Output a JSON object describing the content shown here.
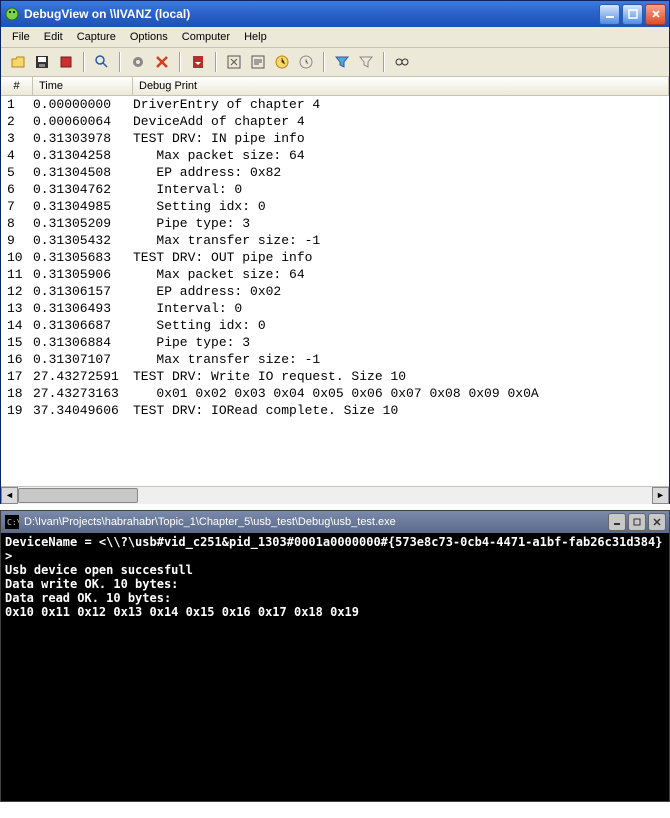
{
  "debugview": {
    "title": "DebugView on \\\\IVANZ (local)",
    "menu": [
      "File",
      "Edit",
      "Capture",
      "Options",
      "Computer",
      "Help"
    ],
    "columns": {
      "num": "#",
      "time": "Time",
      "msg": "Debug Print"
    },
    "rows": [
      {
        "n": "1",
        "t": "0.00000000",
        "m": "DriverEntry of chapter 4"
      },
      {
        "n": "2",
        "t": "0.00060064",
        "m": "DeviceAdd of chapter 4"
      },
      {
        "n": "3",
        "t": "0.31303978",
        "m": "TEST DRV: IN pipe info"
      },
      {
        "n": "4",
        "t": "0.31304258",
        "m": "   Max packet size: 64"
      },
      {
        "n": "5",
        "t": "0.31304508",
        "m": "   EP address: 0x82"
      },
      {
        "n": "6",
        "t": "0.31304762",
        "m": "   Interval: 0"
      },
      {
        "n": "7",
        "t": "0.31304985",
        "m": "   Setting idx: 0"
      },
      {
        "n": "8",
        "t": "0.31305209",
        "m": "   Pipe type: 3"
      },
      {
        "n": "9",
        "t": "0.31305432",
        "m": "   Max transfer size: -1"
      },
      {
        "n": "10",
        "t": "0.31305683",
        "m": "TEST DRV: OUT pipe info"
      },
      {
        "n": "11",
        "t": "0.31305906",
        "m": "   Max packet size: 64"
      },
      {
        "n": "12",
        "t": "0.31306157",
        "m": "   EP address: 0x02"
      },
      {
        "n": "13",
        "t": "0.31306493",
        "m": "   Interval: 0"
      },
      {
        "n": "14",
        "t": "0.31306687",
        "m": "   Setting idx: 0"
      },
      {
        "n": "15",
        "t": "0.31306884",
        "m": "   Pipe type: 3"
      },
      {
        "n": "16",
        "t": "0.31307107",
        "m": "   Max transfer size: -1"
      },
      {
        "n": "17",
        "t": "27.43272591",
        "m": "TEST DRV: Write IO request. Size 10"
      },
      {
        "n": "18",
        "t": "27.43273163",
        "m": "   0x01 0x02 0x03 0x04 0x05 0x06 0x07 0x08 0x09 0x0A"
      },
      {
        "n": "19",
        "t": "37.34049606",
        "m": "TEST DRV: IORead complete. Size 10"
      }
    ]
  },
  "console": {
    "title": "D:\\Ivan\\Projects\\habrahabr\\Topic_1\\Chapter_5\\usb_test\\Debug\\usb_test.exe",
    "lines": [
      "DeviceName = <\\\\?\\usb#vid_c251&pid_1303#0001a0000000#{573e8c73-0cb4-4471-a1bf-fab26c31d384}>",
      "Usb device open succesfull",
      "Data write OK. 10 bytes:",
      "Data read OK. 10 bytes:",
      "0x10 0x11 0x12 0x13 0x14 0x15 0x16 0x17 0x18 0x19"
    ]
  }
}
